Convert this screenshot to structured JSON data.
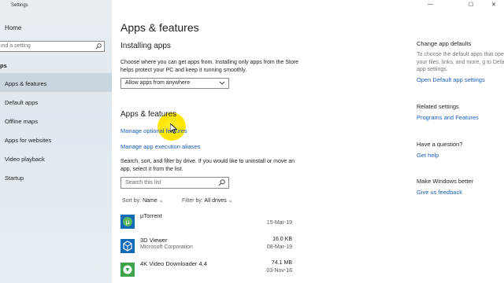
{
  "window": {
    "title": "Settings",
    "controls": [
      "—",
      "☐",
      "✕"
    ]
  },
  "sidebar": {
    "home": "Home",
    "search_placeholder": "ind a setting",
    "section": "ps",
    "items": [
      {
        "label": "Apps & features",
        "active": true
      },
      {
        "label": "Default apps"
      },
      {
        "label": "Offline maps"
      },
      {
        "label": "Apps for websites"
      },
      {
        "label": "Video playback"
      },
      {
        "label": "Startup"
      }
    ]
  },
  "main": {
    "title": "Apps & features",
    "installing": {
      "heading": "Installing apps",
      "description": "Choose where you can get apps from. Installing only apps from the Store helps protect your PC and keep it running smoothly.",
      "dropdown_value": "Allow apps from anywhere"
    },
    "apps": {
      "heading": "Apps & features",
      "link_optional": "Manage optional features",
      "link_aliases": "Manage app execution aliases",
      "description": "Search, sort, and filter by drive. If you would like to uninstall or move an app, select it from the list.",
      "search_placeholder": "Search this list",
      "sort_label": "Sort by:",
      "sort_value": "Name",
      "filter_label": "Filter by:",
      "filter_value": "All drives",
      "list": [
        {
          "name": "µTorrent",
          "publisher": "",
          "size": "",
          "date": "15-Mar-19",
          "icon": "utorrent-icon"
        },
        {
          "name": "3D Viewer",
          "publisher": "Microsoft Corporation",
          "size": "16.0 KB",
          "date": "08-Mar-19",
          "icon": "3d-viewer-icon"
        },
        {
          "name": "4K Video Downloader 4.4",
          "publisher": "",
          "size": "74.1 MB",
          "date": "03-Nov-18",
          "icon": "4k-downloader-icon"
        }
      ]
    }
  },
  "rail": {
    "default_heading": "Change app defaults",
    "default_text": "To choose the default apps that open your files, links, and more, g to Default app settings.",
    "default_link": "Open Default app settings",
    "related_heading": "Related settings",
    "related_link": "Programs and Features",
    "question_heading": "Have a question?",
    "question_link": "Get help",
    "better_heading": "Make Windows better",
    "better_link": "Give us feedback"
  },
  "colors": {
    "link": "#1a5fb4",
    "sidebar_active": "#c9d6df",
    "accent_icon": "#0f6ab8"
  }
}
